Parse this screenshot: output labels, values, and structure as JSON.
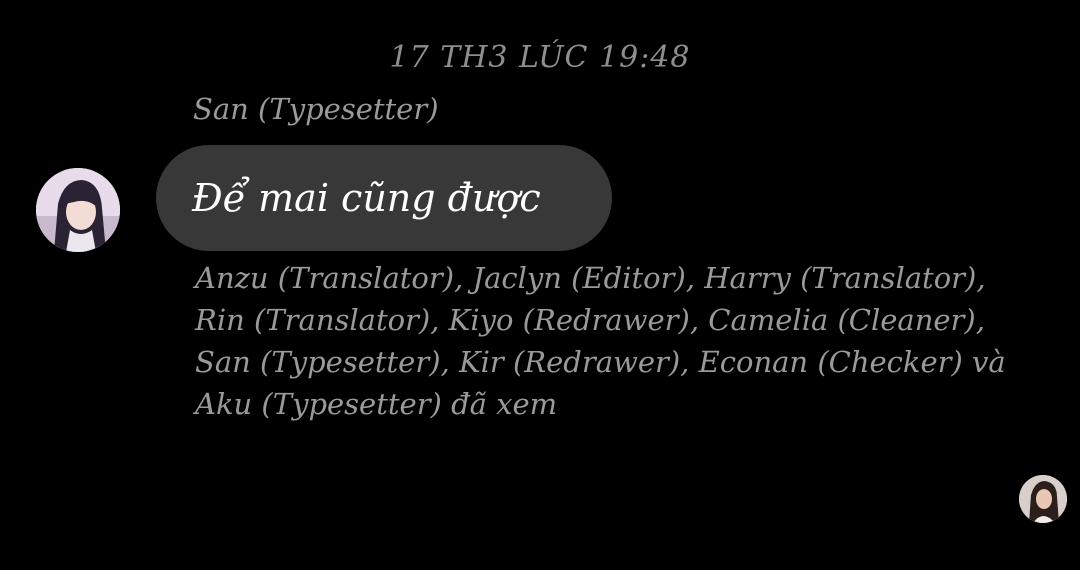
{
  "conversation": {
    "timestamp": "17 TH3 LÚC 19:48",
    "message": {
      "sender_name": "San (Typesetter)",
      "text": "Để mai cũng được",
      "avatar_icon": "user-avatar-anime-girl"
    },
    "seen_by_text": "Anzu (Translator), Jaclyn (Editor), Harry (Translator), Rin (Translator), Kiyo (Redrawer), Camelia (Cleaner), San (Typesetter), Kir (Redrawer), Econan (Checker) và Aku (Typesetter) đã xem",
    "read_receipt_avatar_icon": "user-avatar-photo"
  },
  "colors": {
    "background": "#000000",
    "bubble": "#383838",
    "meta_text": "#9a9a9a",
    "message_text": "#ffffff"
  }
}
